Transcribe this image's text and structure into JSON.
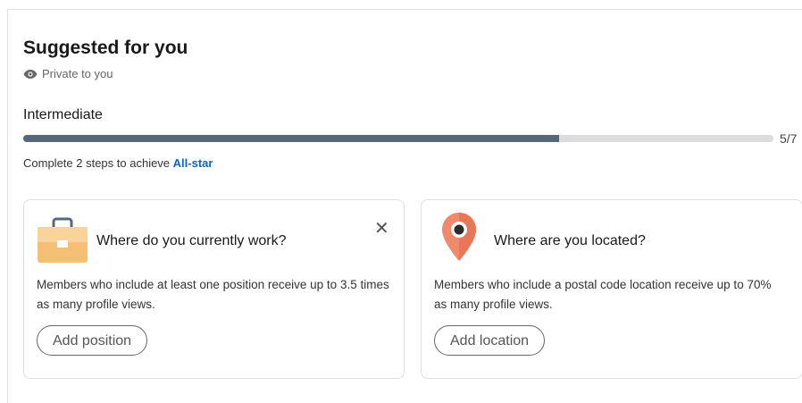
{
  "header": {
    "title": "Suggested for you",
    "privacy_label": "Private to you",
    "privacy_icon": "eye-icon"
  },
  "progress": {
    "level_label": "Intermediate",
    "current": 5,
    "total": 7,
    "count_label": "5/7",
    "hint_prefix": "Complete 2 steps to achieve ",
    "hint_link": "All-star"
  },
  "cards": [
    {
      "icon": "briefcase-icon",
      "heading": "Where do you currently work?",
      "text": "Members who include at least one position receive up to 3.5 times as many profile views.",
      "button_label": "Add position",
      "close_icon": "close-icon"
    },
    {
      "icon": "map-pin-icon",
      "heading": "Where are you located?",
      "text": "Members who include a postal code location receive up to 70% as many profile views.",
      "button_label": "Add location"
    }
  ],
  "colors": {
    "progress_fill": "#56687a",
    "progress_track": "#dcdcdc",
    "link": "#0a66c2",
    "briefcase": "#f5c075",
    "pin": "#f08a6c"
  }
}
